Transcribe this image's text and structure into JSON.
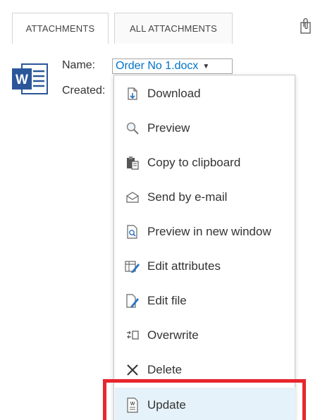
{
  "tabs": [
    {
      "label": "ATTACHMENTS"
    },
    {
      "label": "ALL ATTACHMENTS"
    }
  ],
  "toolbar": {
    "attach_icon": "paperclip-icon"
  },
  "file": {
    "icon": "word-document-icon",
    "name_label": "Name:",
    "created_label": "Created:",
    "name_value": "Order No 1.docx"
  },
  "menu": {
    "items": [
      {
        "label": "Download",
        "icon": "download-icon"
      },
      {
        "label": "Preview",
        "icon": "magnifier-icon"
      },
      {
        "label": "Copy to clipboard",
        "icon": "clipboard-icon"
      },
      {
        "label": "Send by e-mail",
        "icon": "envelope-icon"
      },
      {
        "label": "Preview in new window",
        "icon": "document-search-icon"
      },
      {
        "label": "Edit attributes",
        "icon": "edit-attributes-icon"
      },
      {
        "label": "Edit file",
        "icon": "edit-file-icon"
      },
      {
        "label": "Overwrite",
        "icon": "overwrite-icon"
      },
      {
        "label": "Delete",
        "icon": "delete-x-icon"
      },
      {
        "label": "Update",
        "icon": "word-update-icon"
      }
    ],
    "highlighted": "Update"
  },
  "colors": {
    "link": "#0072c6",
    "word_blue": "#2b579a",
    "highlight_bg": "#e6f2fa",
    "annotation_red": "#e8262e"
  }
}
